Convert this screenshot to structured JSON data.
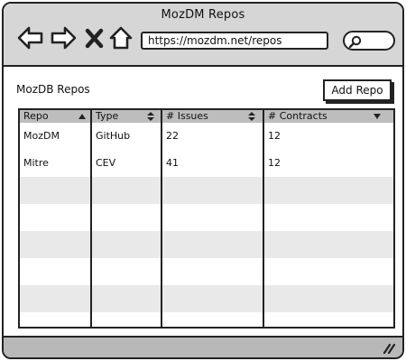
{
  "window": {
    "title": "MozDM Repos"
  },
  "browser": {
    "url": "https://mozdm.net/repos",
    "nav_icons": [
      "back-arrow-icon",
      "forward-arrow-icon",
      "close-x-icon",
      "home-icon"
    ],
    "search_icon": "search-icon"
  },
  "page": {
    "heading": "MozDB Repos",
    "add_button_label": "Add Repo"
  },
  "table": {
    "columns": [
      {
        "label": "Repo",
        "sort": "ascending"
      },
      {
        "label": "Type",
        "sort": "both"
      },
      {
        "label": "# Issues",
        "sort": "both"
      },
      {
        "label": "# Contracts",
        "sort": "descending"
      }
    ],
    "rows": [
      [
        "MozDM",
        "GitHub",
        "22",
        "12"
      ],
      [
        "Mitre",
        "CEV",
        "41",
        "12"
      ],
      [
        "",
        "",
        "",
        ""
      ],
      [
        "",
        "",
        "",
        ""
      ],
      [
        "",
        "",
        "",
        ""
      ],
      [
        "",
        "",
        "",
        ""
      ],
      [
        "",
        "",
        "",
        ""
      ],
      [
        "",
        "",
        "",
        ""
      ]
    ]
  },
  "colors": {
    "titlebar": "#d6d6d6",
    "header": "#bdbdbd",
    "row_shade": "#e9e9e9",
    "statusbar": "#b8b8b8",
    "stroke": "#222222"
  }
}
